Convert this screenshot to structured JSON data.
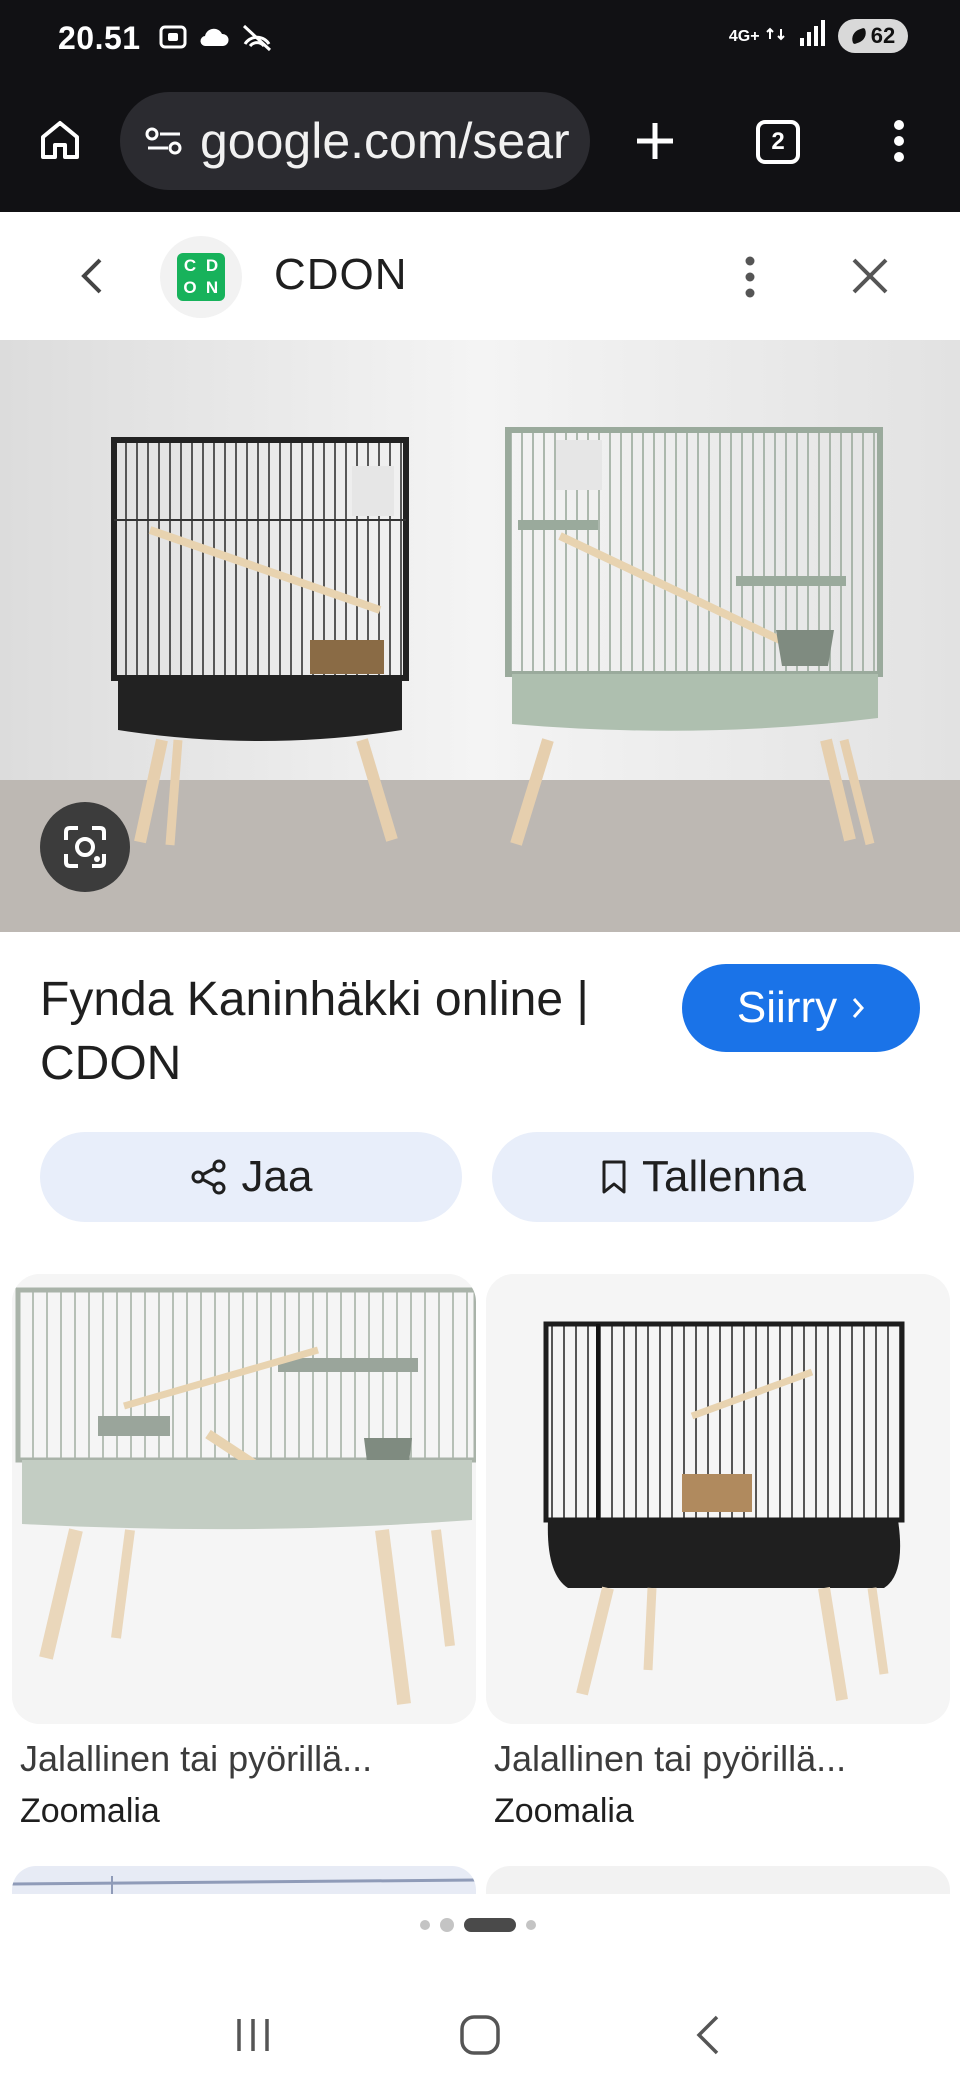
{
  "status_bar": {
    "time": "20.51",
    "network": "4G+",
    "battery": "62",
    "icons_left": [
      "screenshot-icon",
      "cloud-icon",
      "hotspot-icon"
    ],
    "icons_right": [
      "network-arrows-icon",
      "signal-icon",
      "battery-saver-icon"
    ]
  },
  "browser": {
    "url": "google.com/sear",
    "tab_count": "2"
  },
  "sheet": {
    "site_name": "CDON",
    "logo_letters": [
      "C",
      "D",
      "O",
      "N"
    ]
  },
  "result": {
    "title": "Fynda Kaninhäkki online | CDON",
    "visit_label": "Siirry",
    "share_label": "Jaa",
    "save_label": "Tallenna"
  },
  "related": [
    {
      "title": "Jalallinen tai pyörillä...",
      "source": "Zoomalia"
    },
    {
      "title": "Jalallinen tai pyörillä...",
      "source": "Zoomalia"
    }
  ],
  "colors": {
    "accent": "#1a73e8",
    "chip_bg": "#e8eefa",
    "chrome_bg": "#111114",
    "brand_green": "#17b25b"
  }
}
